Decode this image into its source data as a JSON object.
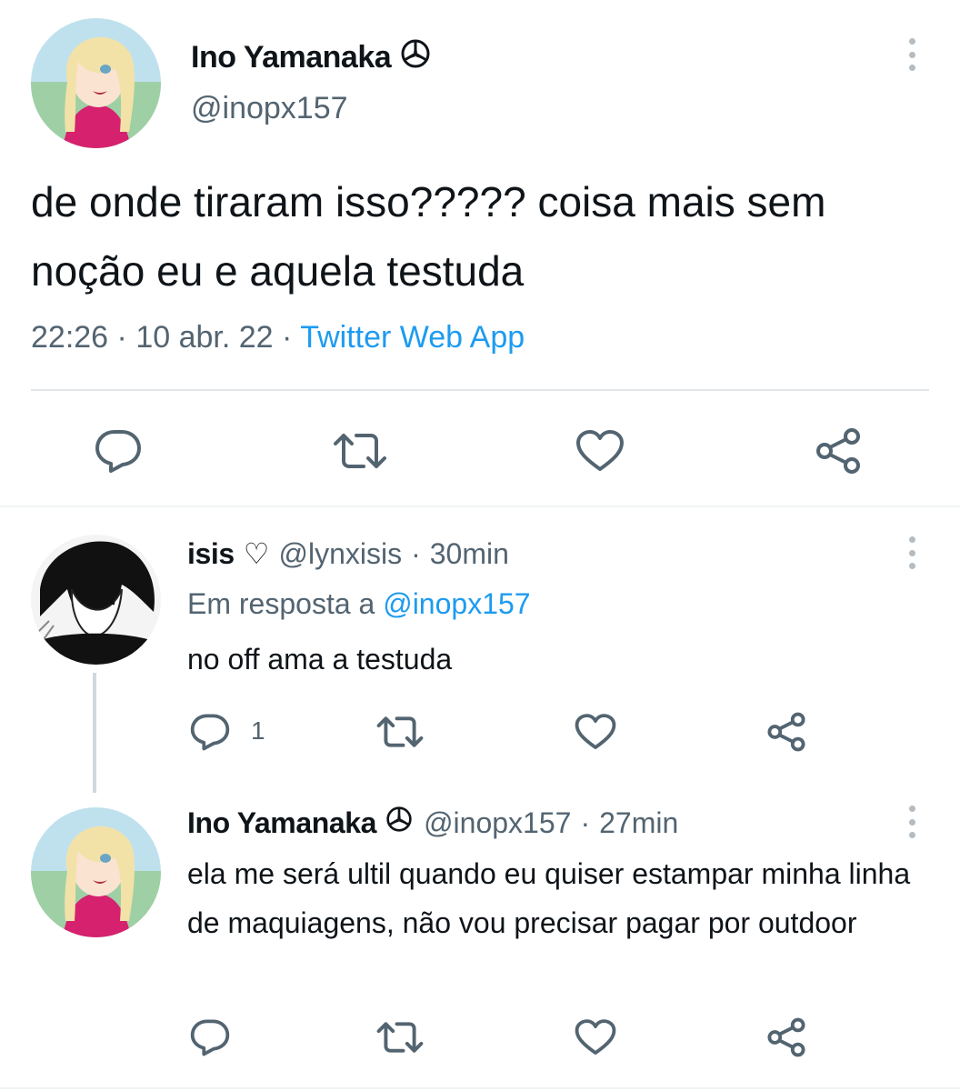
{
  "main_tweet": {
    "author_name": "Ino Yamanaka",
    "author_emblem": "mercedes-star-icon",
    "handle": "@inopx157",
    "text": "de onde tiraram isso????? coisa mais sem noção eu e aquela testuda",
    "time": "22:26",
    "date": "10 abr. 22",
    "source": "Twitter Web App",
    "separator": "·"
  },
  "actions": {
    "reply_icon": "speech-bubble-icon",
    "retweet_icon": "retweet-icon",
    "like_icon": "heart-icon",
    "share_icon": "share-icon"
  },
  "replies": [
    {
      "author_name": "isis",
      "author_badge": "♡",
      "handle": "@lynxisis",
      "separator": "·",
      "time": "30min",
      "reply_to_label": "Em resposta a",
      "reply_to_handle": "@inopx157",
      "text": "no off ama a testuda",
      "reply_count": "1"
    },
    {
      "author_name": "Ino Yamanaka",
      "author_emblem": "mercedes-star-icon",
      "handle": "@inopx157",
      "separator": "·",
      "time": "27min",
      "text": "ela me será ultil quando eu quiser estampar minha linha de maquiagens, não vou precisar pagar por outdoor"
    }
  ],
  "colors": {
    "accent": "#1d9bf0",
    "muted_text": "#536471",
    "icon": "#536471",
    "divider": "#e2e6e9",
    "avatar_hair": "#f2e2a8",
    "avatar_top": "#d6216e"
  }
}
